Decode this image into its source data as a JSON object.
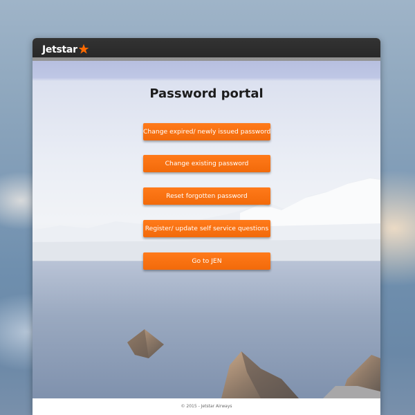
{
  "header": {
    "logo_text": "Jetstar",
    "logo_icon": "star-icon",
    "brand_color": "#ff6a00"
  },
  "main": {
    "title": "Password portal",
    "buttons": [
      {
        "label": "Change expired/ newly issued password"
      },
      {
        "label": "Change existing password"
      },
      {
        "label": "Reset forgotten password"
      },
      {
        "label": "Register/ update self service questions"
      },
      {
        "label": "Go to JEN"
      }
    ],
    "button_color": "#f26a0a"
  },
  "footer": {
    "copyright": "© 2015 - Jetstar Airways"
  }
}
